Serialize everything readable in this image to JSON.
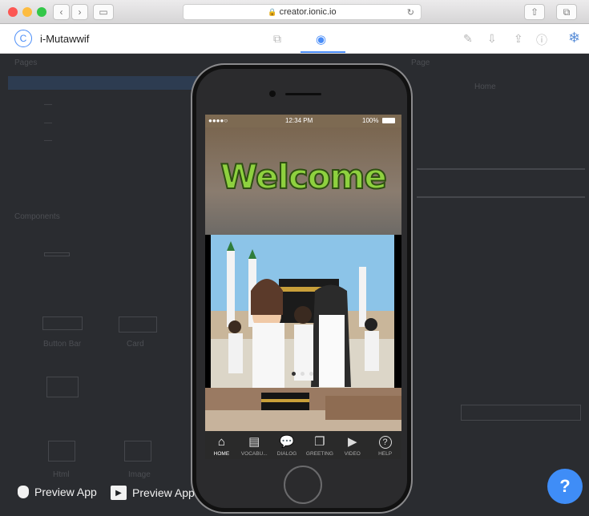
{
  "browser": {
    "url": "creator.ionic.io",
    "traffic_lights": [
      "#fc5753",
      "#fdbc40",
      "#33c748"
    ]
  },
  "app": {
    "name": "i-Mutawwif",
    "logo_glyph": "C",
    "accent": "#4a8df8"
  },
  "editor_background": {
    "left_panel": [
      "Pages",
      "Components"
    ],
    "component_labels": [
      "Button Bar",
      "Card",
      "Html",
      "Image"
    ],
    "right_panel": [
      "Page",
      "Home"
    ]
  },
  "phone": {
    "status": {
      "carrier": "●●●●○ ",
      "time": "12:34 PM",
      "battery": "100%"
    },
    "welcome_text": "Welcome",
    "slide_index": 0,
    "slide_count": 3,
    "tabs": [
      {
        "label": "HOME",
        "icon": "home-icon",
        "glyph": "⌂",
        "active": true
      },
      {
        "label": "VOCABU...",
        "icon": "document-icon",
        "glyph": "▤",
        "active": false
      },
      {
        "label": "DIALOG",
        "icon": "chat-icon",
        "glyph": "💬",
        "active": false
      },
      {
        "label": "GREETING",
        "icon": "chats-icon",
        "glyph": "❐",
        "active": false
      },
      {
        "label": "VIDEO",
        "icon": "play-icon",
        "glyph": "▶",
        "active": false
      },
      {
        "label": "HELP",
        "icon": "help-icon",
        "glyph": "?",
        "active": false
      }
    ]
  },
  "preview_buttons": [
    {
      "label": "Preview App",
      "icon": "apple-icon",
      "glyph": ""
    },
    {
      "label": "Preview App",
      "icon": "play-store-icon",
      "glyph": "▶"
    }
  ],
  "help_button": {
    "glyph": "?"
  }
}
